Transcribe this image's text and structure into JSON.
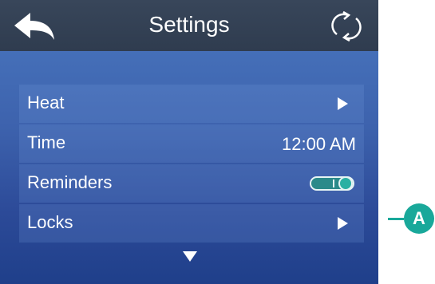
{
  "header": {
    "title": "Settings",
    "back_icon": "back-arrow-icon",
    "refresh_icon": "refresh-icon"
  },
  "settings": [
    {
      "label": "Heat",
      "control": "chevron-right-icon"
    },
    {
      "label": "Time",
      "value": "12:00 AM"
    },
    {
      "label": "Reminders",
      "control": "toggle",
      "toggle_on": true
    },
    {
      "label": "Locks",
      "control": "chevron-right-icon"
    }
  ],
  "scroll": {
    "icon": "chevron-down-icon"
  },
  "callout": {
    "label": "A"
  },
  "colors": {
    "titlebar": "#2f3c4f",
    "background_top": "#4a78c0",
    "background_bottom": "#1f3f8a",
    "accent": "#19a89a"
  }
}
